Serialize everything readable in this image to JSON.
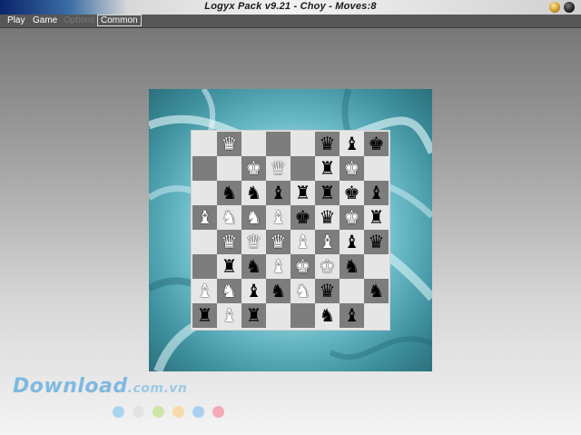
{
  "window": {
    "title": "Logyx Pack v9.21 - Choy - Moves:8"
  },
  "menu": [
    {
      "label": "Play",
      "state": "normal"
    },
    {
      "label": "Game",
      "state": "normal"
    },
    {
      "label": "Options",
      "state": "disabled"
    },
    {
      "label": "Common",
      "state": "active"
    }
  ],
  "board": {
    "rows": [
      [
        "",
        "wQ",
        "",
        "",
        "",
        "bQ",
        "bB",
        "bK"
      ],
      [
        "",
        "",
        "wK",
        "wQ",
        "",
        "bR",
        "wK",
        ""
      ],
      [
        "",
        "bN",
        "bN",
        "bB",
        "bR",
        "bR",
        "bK",
        "bB"
      ],
      [
        "wB",
        "wN",
        "wN",
        "wB",
        "bK",
        "bQ",
        "wK",
        "bR"
      ],
      [
        "",
        "wQ",
        "wQ",
        "wQ",
        "wB",
        "wB",
        "bB",
        "bQ"
      ],
      [
        "",
        "bR",
        "bN",
        "wB",
        "wK",
        "wK",
        "bN",
        ""
      ],
      [
        "wB",
        "wN",
        "bB",
        "bN",
        "wN",
        "bQ",
        "",
        "bN"
      ],
      [
        "bR",
        "wB",
        "bR",
        "",
        "",
        "bN",
        "bB",
        ""
      ]
    ]
  },
  "watermark": {
    "brand": "Download",
    "domain": ".com.vn"
  },
  "dot_colors": [
    "#a9d4f2",
    "#e2e2e2",
    "#cde6a8",
    "#f6dca8",
    "#a9d0f0",
    "#f4aab8"
  ]
}
